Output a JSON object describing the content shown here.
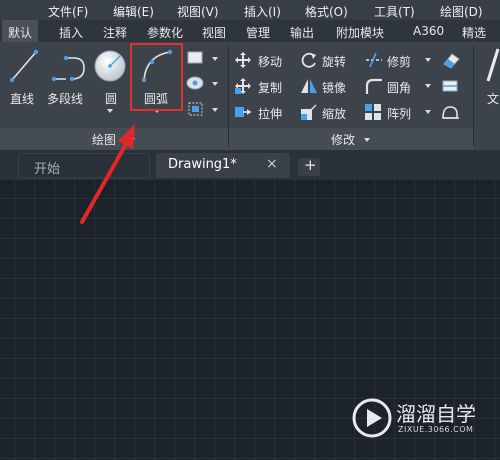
{
  "menubar": {
    "items": [
      "文件(F)",
      "编辑(E)",
      "视图(V)",
      "插入(I)",
      "格式(O)",
      "工具(T)",
      "绘图(D)"
    ]
  },
  "ribbon_tabs": {
    "items": [
      "默认",
      "插入",
      "注释",
      "参数化",
      "视图",
      "管理",
      "输出",
      "附加模块",
      "A360",
      "精选"
    ],
    "active": "默认"
  },
  "draw_panel": {
    "title": "绘图",
    "line": "直线",
    "polyline": "多段线",
    "circle": "圆",
    "arc": "圆弧"
  },
  "modify_panel": {
    "title": "修改",
    "move": "移动",
    "rotate": "旋转",
    "trim": "修剪",
    "copy": "复制",
    "mirror": "镜像",
    "fillet": "圆角",
    "stretch": "拉伸",
    "scale": "缩放",
    "array": "阵列"
  },
  "ribbon_overflow_text": "文",
  "doc_tabs": {
    "start": "开始",
    "drawing": "Drawing1*",
    "close": "×",
    "new": "+"
  },
  "watermark": {
    "name": "溜溜自学",
    "url": "ZIXUE.3066.COM"
  },
  "colors": {
    "highlight_box": "#e03030",
    "arrow": "#e02828",
    "ribbon_bg": "#3d434b",
    "canvas_bg": "#1c222a"
  }
}
